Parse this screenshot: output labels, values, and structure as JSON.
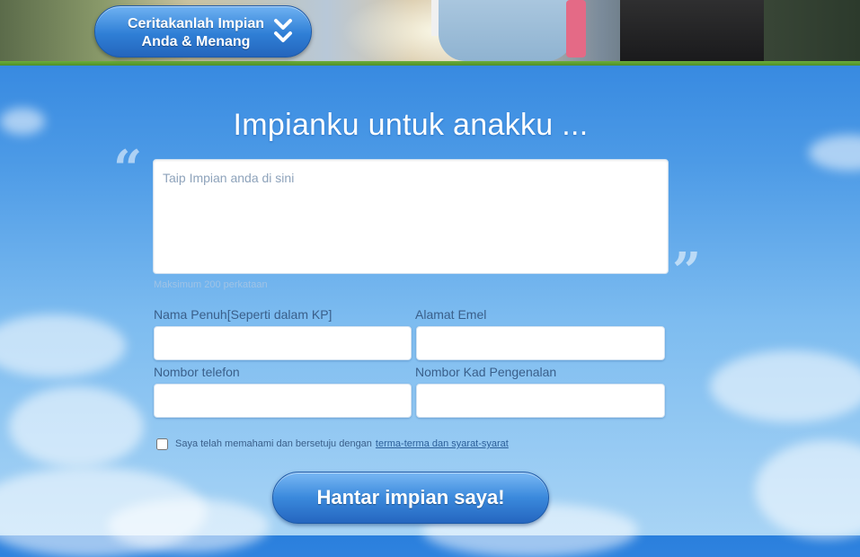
{
  "header": {
    "cta_line1": "Ceritakanlah Impian",
    "cta_line2": "Anda & Menang",
    "cta_icon": "double-chevron-down-icon"
  },
  "form": {
    "heading": "Impianku untuk anakku ...",
    "dream_placeholder": "Taip Impian anda di sini",
    "dream_value": "",
    "max_note": "Maksimum 200 perkataan",
    "fullname_label": "Nama Penuh[Seperti dalam KP]",
    "email_label": "Alamat Emel",
    "phone_label": "Nombor telefon",
    "ic_label": "Nombor Kad Pengenalan",
    "agree_text": "Saya telah memahami dan bersetuju dengan",
    "agree_link": "terma-terma dan syarat-syarat",
    "agree_checked": false,
    "submit_label": "Hantar impian saya!"
  },
  "colors": {
    "sky_top": "#2a7fdd",
    "sky_bottom": "#a8d4f5",
    "button_blue": "#2f7fd6",
    "accent_green": "#6cae3a",
    "label_text": "#3a5f8a"
  }
}
